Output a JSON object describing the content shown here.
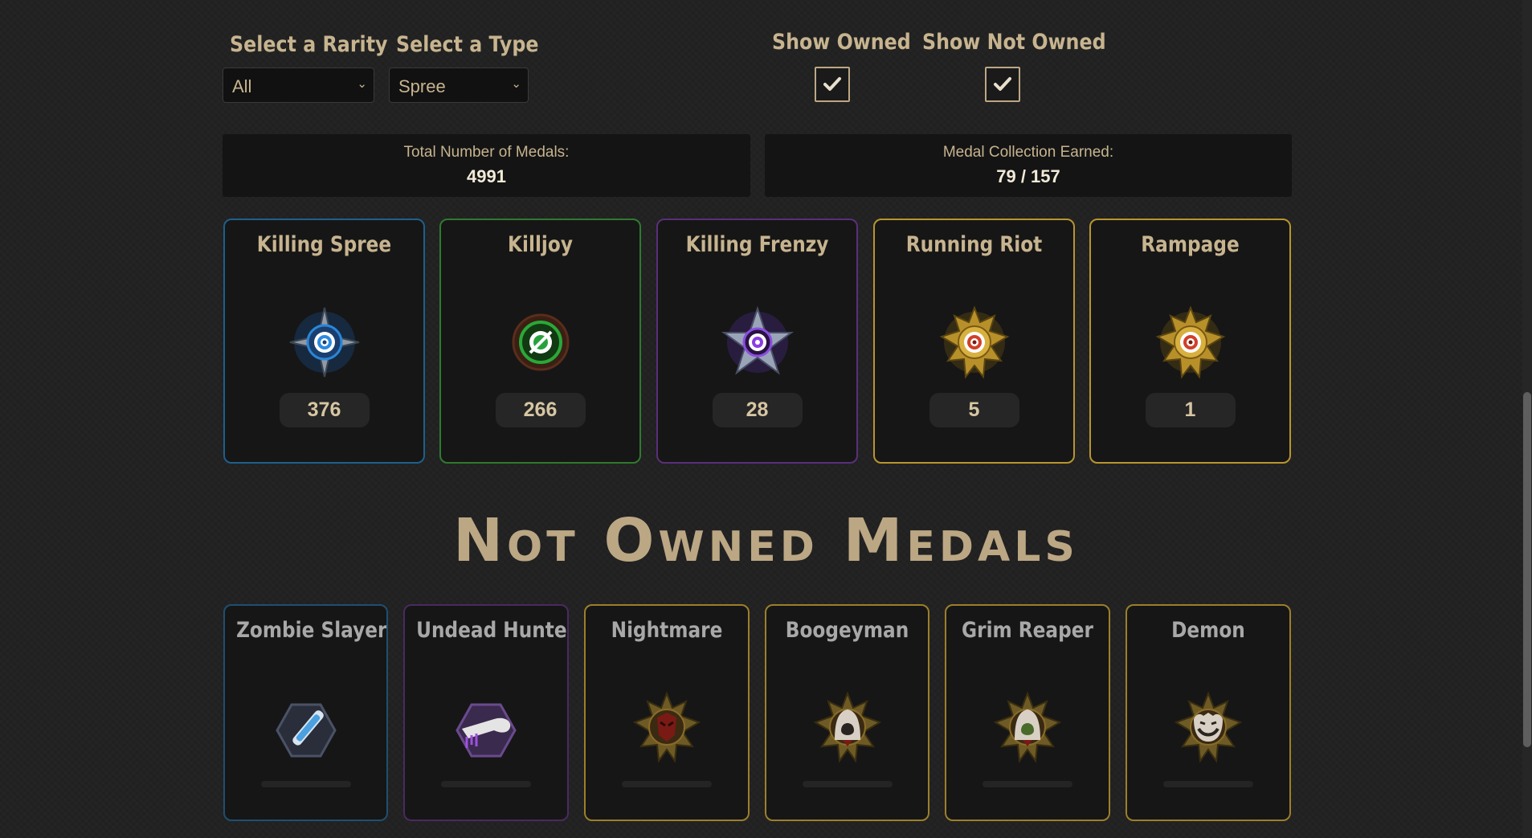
{
  "filters": {
    "rarity_label": "Select a Rarity",
    "rarity_value": "All",
    "type_label": "Select a Type",
    "type_value": "Spree",
    "show_owned_label": "Show Owned",
    "show_not_owned_label": "Show Not Owned",
    "show_owned_checked": true,
    "show_not_owned_checked": true
  },
  "stats": {
    "total_label": "Total Number of Medals:",
    "total_value": "4991",
    "collection_label": "Medal Collection Earned:",
    "collection_value": "79 / 157"
  },
  "owned": [
    {
      "name": "Killing Spree",
      "count": "376",
      "rarity_color": "#1f5f8c",
      "icon": "killing-spree-medal-icon"
    },
    {
      "name": "Killjoy",
      "count": "266",
      "rarity_color": "#2f7a2f",
      "icon": "killjoy-medal-icon"
    },
    {
      "name": "Killing Frenzy",
      "count": "28",
      "rarity_color": "#5a2f7a",
      "icon": "killing-frenzy-medal-icon"
    },
    {
      "name": "Running Riot",
      "count": "5",
      "rarity_color": "#b8952e",
      "icon": "running-riot-medal-icon"
    },
    {
      "name": "Rampage",
      "count": "1",
      "rarity_color": "#b8952e",
      "icon": "rampage-medal-icon"
    }
  ],
  "not_owned_heading": "Not Owned Medals",
  "not_owned": [
    {
      "name": "Zombie Slayer",
      "rarity_color": "#1f4f70",
      "icon": "zombie-slayer-medal-icon"
    },
    {
      "name": "Undead Hunter",
      "rarity_color": "#4a2a60",
      "icon": "undead-hunter-medal-icon"
    },
    {
      "name": "Nightmare",
      "rarity_color": "#9c7f2a",
      "icon": "nightmare-medal-icon"
    },
    {
      "name": "Boogeyman",
      "rarity_color": "#9c7f2a",
      "icon": "boogeyman-medal-icon"
    },
    {
      "name": "Grim Reaper",
      "rarity_color": "#9c7f2a",
      "icon": "grim-reaper-medal-icon"
    },
    {
      "name": "Demon",
      "rarity_color": "#9c7f2a",
      "icon": "demon-medal-icon"
    }
  ],
  "colors": {
    "accent_gold": "#c7b48f",
    "background": "#222222",
    "card_background": "#161616"
  }
}
